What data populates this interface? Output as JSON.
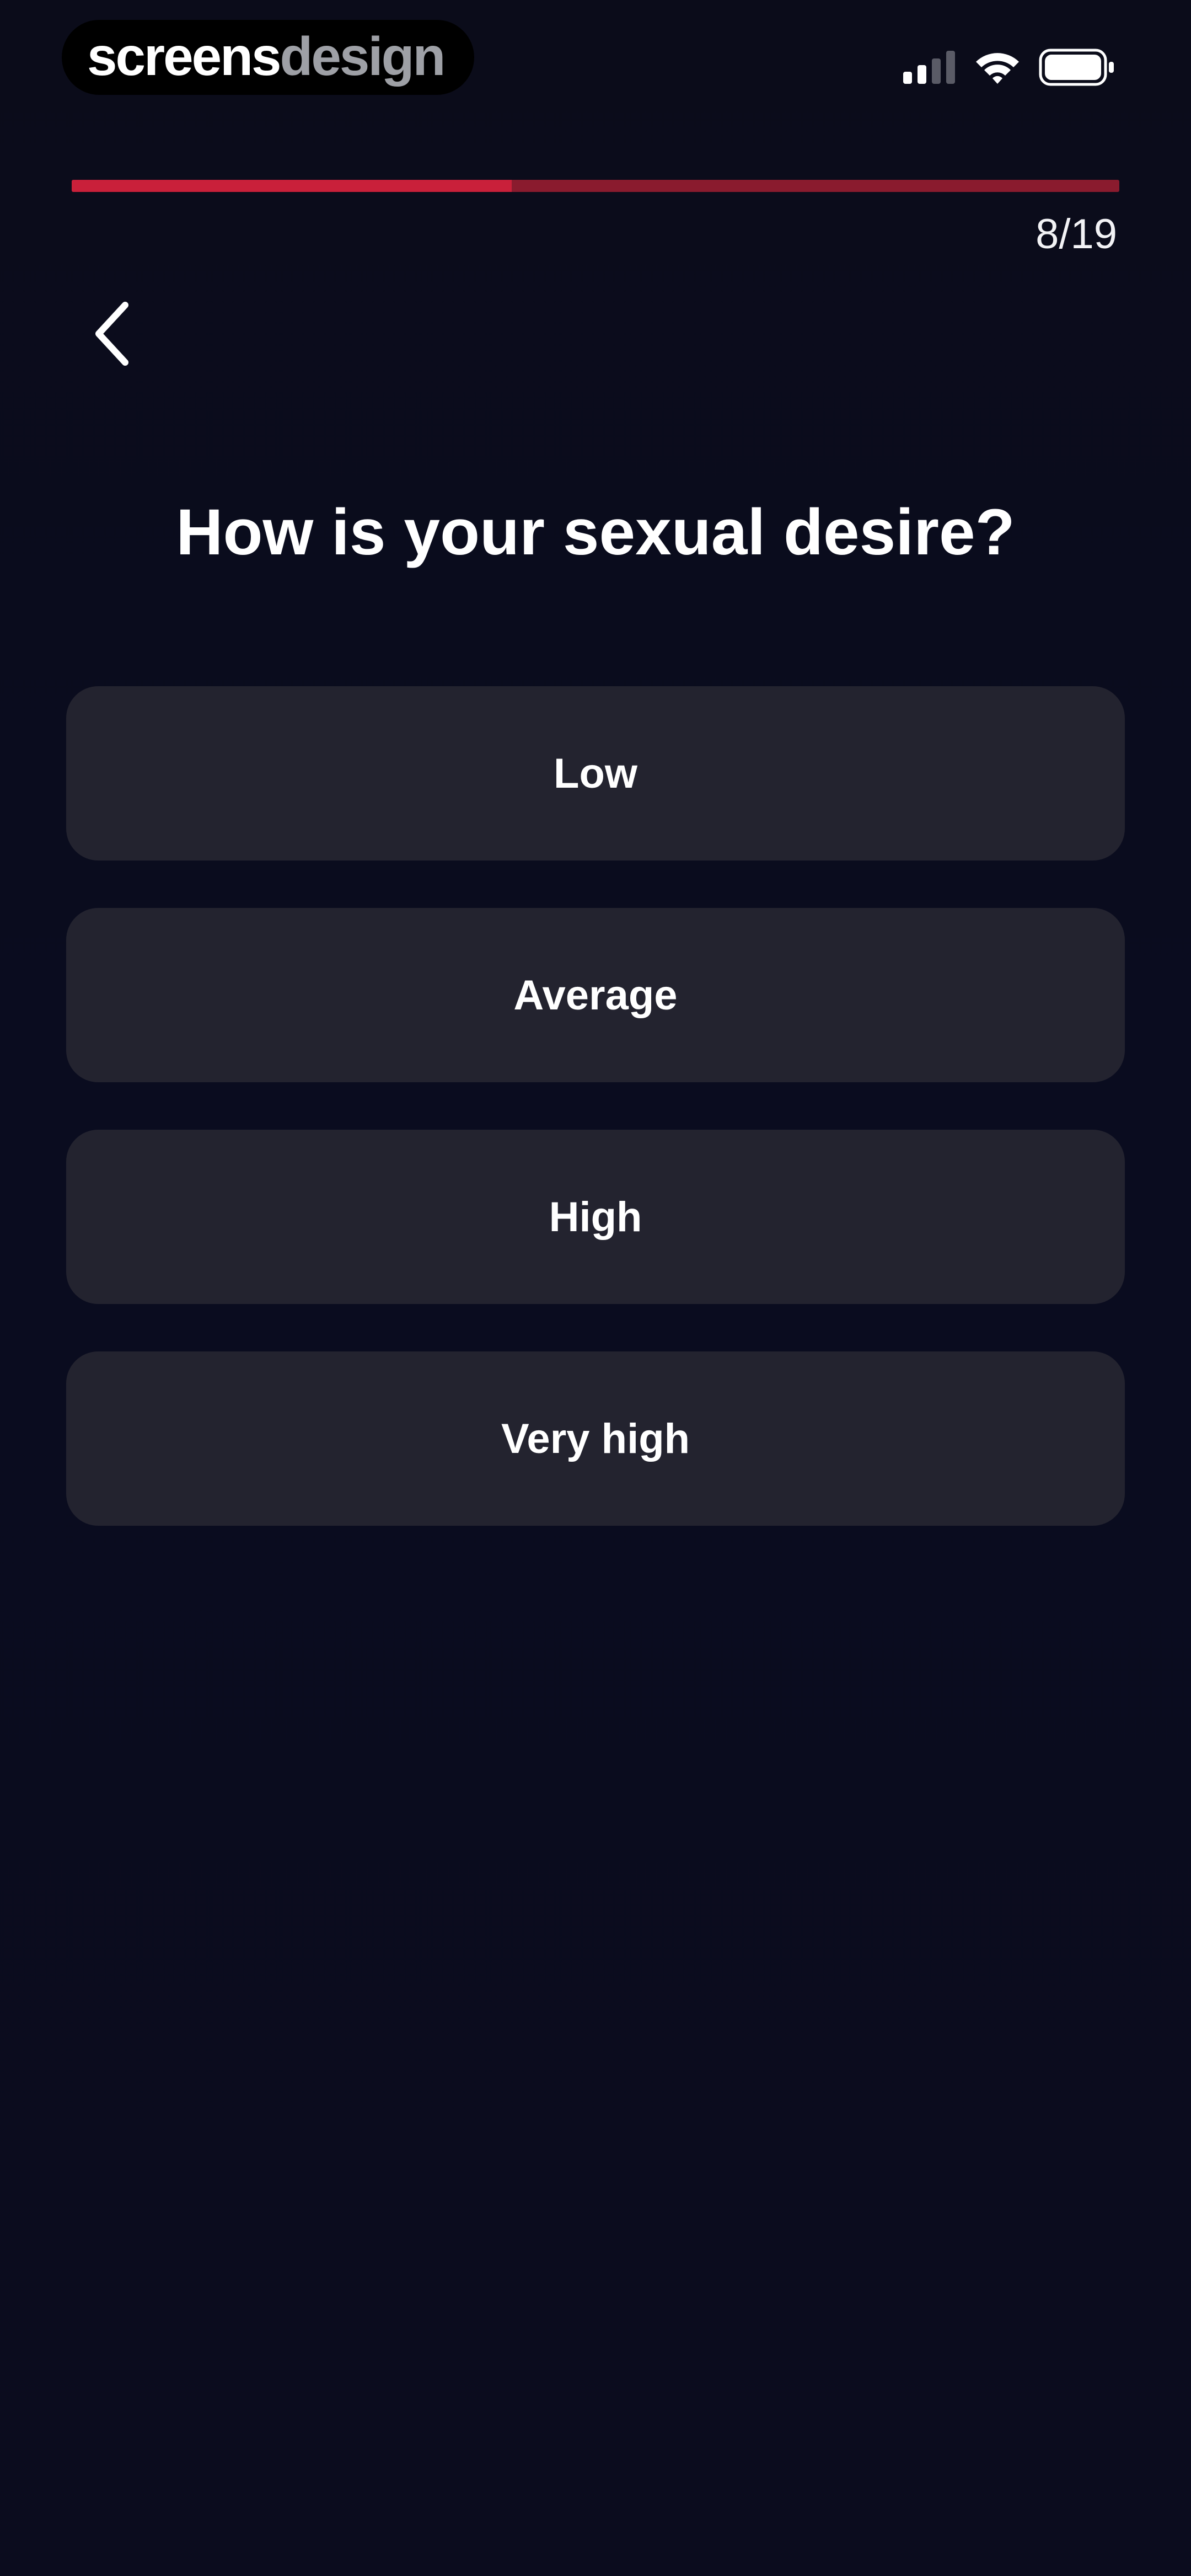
{
  "status_bar": {
    "brand_part1": "screens",
    "brand_part2": "design"
  },
  "progress": {
    "current": 8,
    "total": 19,
    "fraction": 0.42,
    "label": "8/19"
  },
  "question": {
    "title": "How is your sexual desire?"
  },
  "options": [
    {
      "label": "Low"
    },
    {
      "label": "Average"
    },
    {
      "label": "High"
    },
    {
      "label": "Very high"
    }
  ],
  "colors": {
    "background": "#0b0c1b",
    "progress_fill": "#c9203a",
    "progress_track": "#8a1b2e",
    "option_background": "#23232f",
    "text": "#ffffff"
  },
  "icons": {
    "back": "chevron-left-icon",
    "signal": "cellular-signal-icon",
    "wifi": "wifi-icon",
    "battery": "battery-icon"
  }
}
